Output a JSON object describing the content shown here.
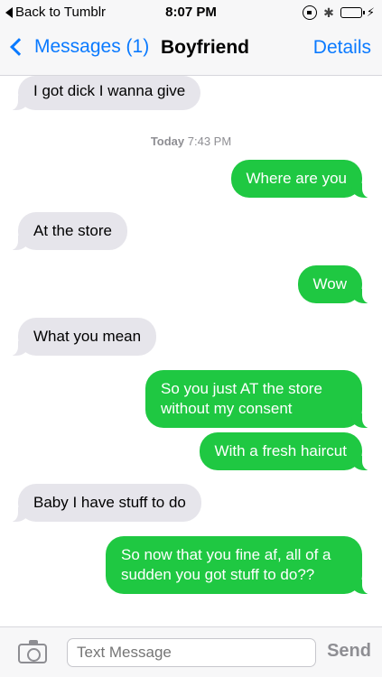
{
  "status_bar": {
    "back_label": "Back to Tumblr",
    "time": "8:07 PM",
    "icons": [
      "orientation-lock-icon",
      "bluetooth-icon",
      "battery-icon",
      "charging-icon"
    ]
  },
  "nav": {
    "back_label": "Messages (1)",
    "title": "Boyfriend",
    "details_label": "Details"
  },
  "timestamp": {
    "day": "Today",
    "time": "7:43 PM"
  },
  "messages": [
    {
      "direction": "incoming",
      "text": "I got dick I wanna give"
    },
    {
      "direction": "outgoing",
      "text": "Where are you"
    },
    {
      "direction": "incoming",
      "text": "At the store"
    },
    {
      "direction": "outgoing",
      "text": "Wow"
    },
    {
      "direction": "incoming",
      "text": "What you mean"
    },
    {
      "direction": "outgoing",
      "text": "So you just AT the store without my consent"
    },
    {
      "direction": "outgoing",
      "text": "With a fresh haircut"
    },
    {
      "direction": "incoming",
      "text": "Baby I have stuff to do"
    },
    {
      "direction": "outgoing",
      "text": "So now that you fine af, all of a sudden you got stuff to do??"
    }
  ],
  "composer": {
    "placeholder": "Text Message",
    "send_label": "Send"
  },
  "colors": {
    "accent_blue": "#0a7aff",
    "outgoing_bubble": "#1fc842",
    "incoming_bubble": "#e6e5eb"
  }
}
